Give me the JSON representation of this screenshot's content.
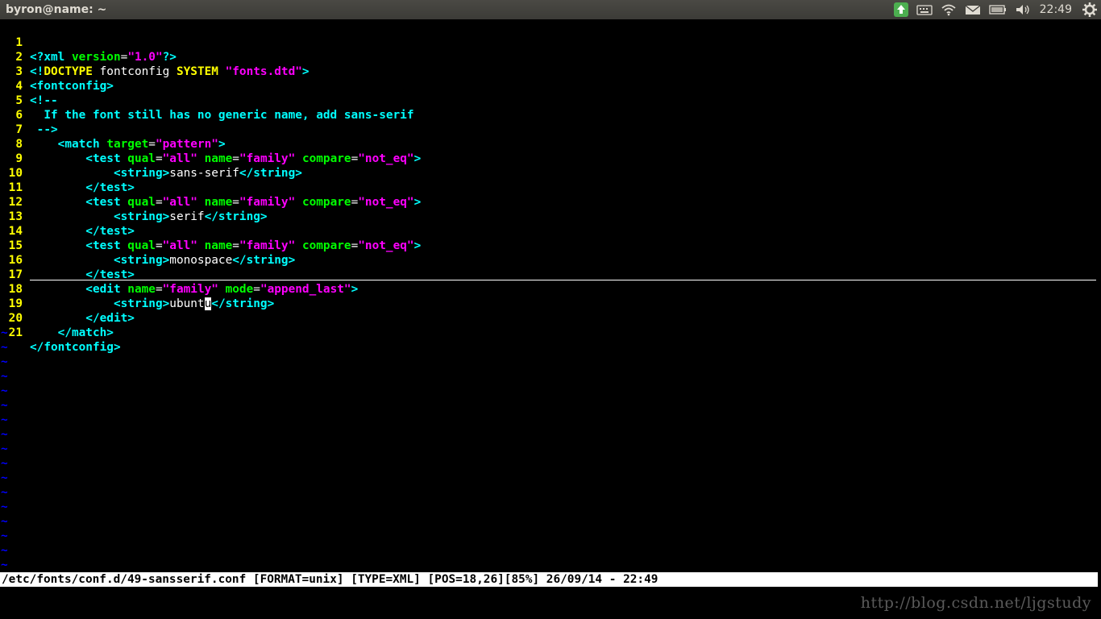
{
  "window": {
    "title": "byron@name: ~"
  },
  "tray": {
    "icons": [
      "update-icon",
      "keyboard-icon",
      "wifi-icon",
      "mail-icon",
      "battery-icon",
      "volume-icon",
      "settings-gear-icon"
    ],
    "clock": "22:49"
  },
  "editor": {
    "lines": [
      {
        "n": "1"
      },
      {
        "n": "2"
      },
      {
        "n": "3"
      },
      {
        "n": "4"
      },
      {
        "n": "5"
      },
      {
        "n": "6"
      },
      {
        "n": "7"
      },
      {
        "n": "8"
      },
      {
        "n": "9"
      },
      {
        "n": "10"
      },
      {
        "n": "11"
      },
      {
        "n": "12"
      },
      {
        "n": "13"
      },
      {
        "n": "14"
      },
      {
        "n": "15"
      },
      {
        "n": "16"
      },
      {
        "n": "17"
      },
      {
        "n": "18"
      },
      {
        "n": "19"
      },
      {
        "n": "20"
      },
      {
        "n": "21"
      }
    ],
    "tildes": [
      "~",
      "~",
      "~",
      "~",
      "~",
      "~",
      "~",
      "~",
      "~",
      "~",
      "~",
      "~",
      "~",
      "~",
      "~",
      "~",
      "~"
    ],
    "status": "/etc/fonts/conf.d/49-sansserif.conf [FORMAT=unix] [TYPE=XML] [POS=18,26][85%] 26/09/14 - 22:49"
  },
  "watermark": "http://blog.csdn.net/ljgstudy"
}
